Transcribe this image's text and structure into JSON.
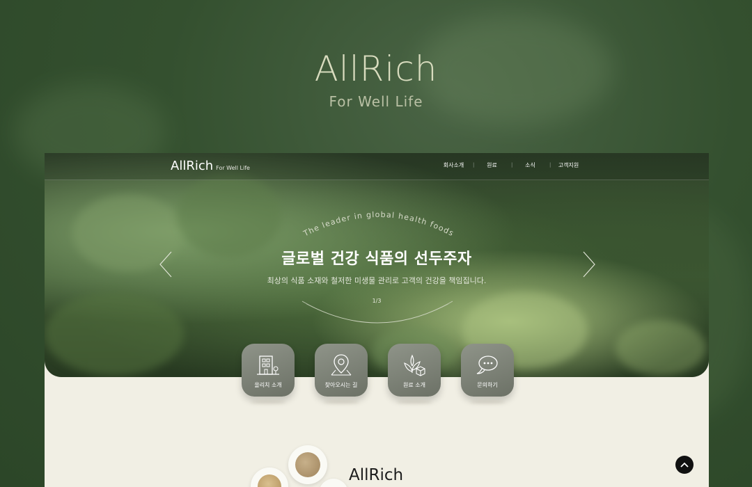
{
  "hero": {
    "logo": "AllRich",
    "tagline": "For Well Life"
  },
  "nav": {
    "logo": "AllRich",
    "logo_sub": "For Well Life",
    "items": [
      "회사소개",
      "원료",
      "소식",
      "고객지원"
    ]
  },
  "banner": {
    "curve_text": "The leader in global health foods",
    "title": "글로벌 건강 식품의 선두주자",
    "subtitle": "최상의 식품 소재와 철저한 미생물 관리로 고객의 건강을 책임집니다.",
    "pager": "1/3"
  },
  "quick_links": [
    {
      "label": "올리치 소개",
      "icon": "building-icon"
    },
    {
      "label": "찾아오시는 길",
      "icon": "map-pin-icon"
    },
    {
      "label": "원료 소개",
      "icon": "plant-box-icon"
    },
    {
      "label": "문의하기",
      "icon": "chat-bubble-icon"
    }
  ],
  "about": {
    "logo": "AllRich"
  },
  "colors": {
    "brand_green": "#34502f",
    "cream": "#f1efe4",
    "button_gray": "#7d8277"
  }
}
